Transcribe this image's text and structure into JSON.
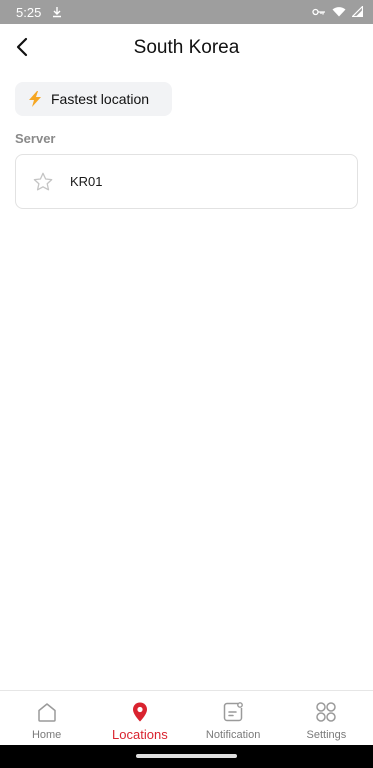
{
  "status_bar": {
    "time": "5:25"
  },
  "header": {
    "title": "South Korea"
  },
  "fastest": {
    "label": "Fastest location"
  },
  "server_section": {
    "label": "Server",
    "items": [
      {
        "name": "KR01"
      }
    ]
  },
  "bottom_nav": {
    "items": [
      {
        "label": "Home",
        "icon": "home-icon"
      },
      {
        "label": "Locations",
        "icon": "location-pin-icon"
      },
      {
        "label": "Notification",
        "icon": "notification-icon"
      },
      {
        "label": "Settings",
        "icon": "grid-icon"
      }
    ],
    "active": "Locations"
  },
  "colors": {
    "accent": "#d9232f",
    "bolt": "#f5a623",
    "status_bar": "#9e9e9e"
  }
}
